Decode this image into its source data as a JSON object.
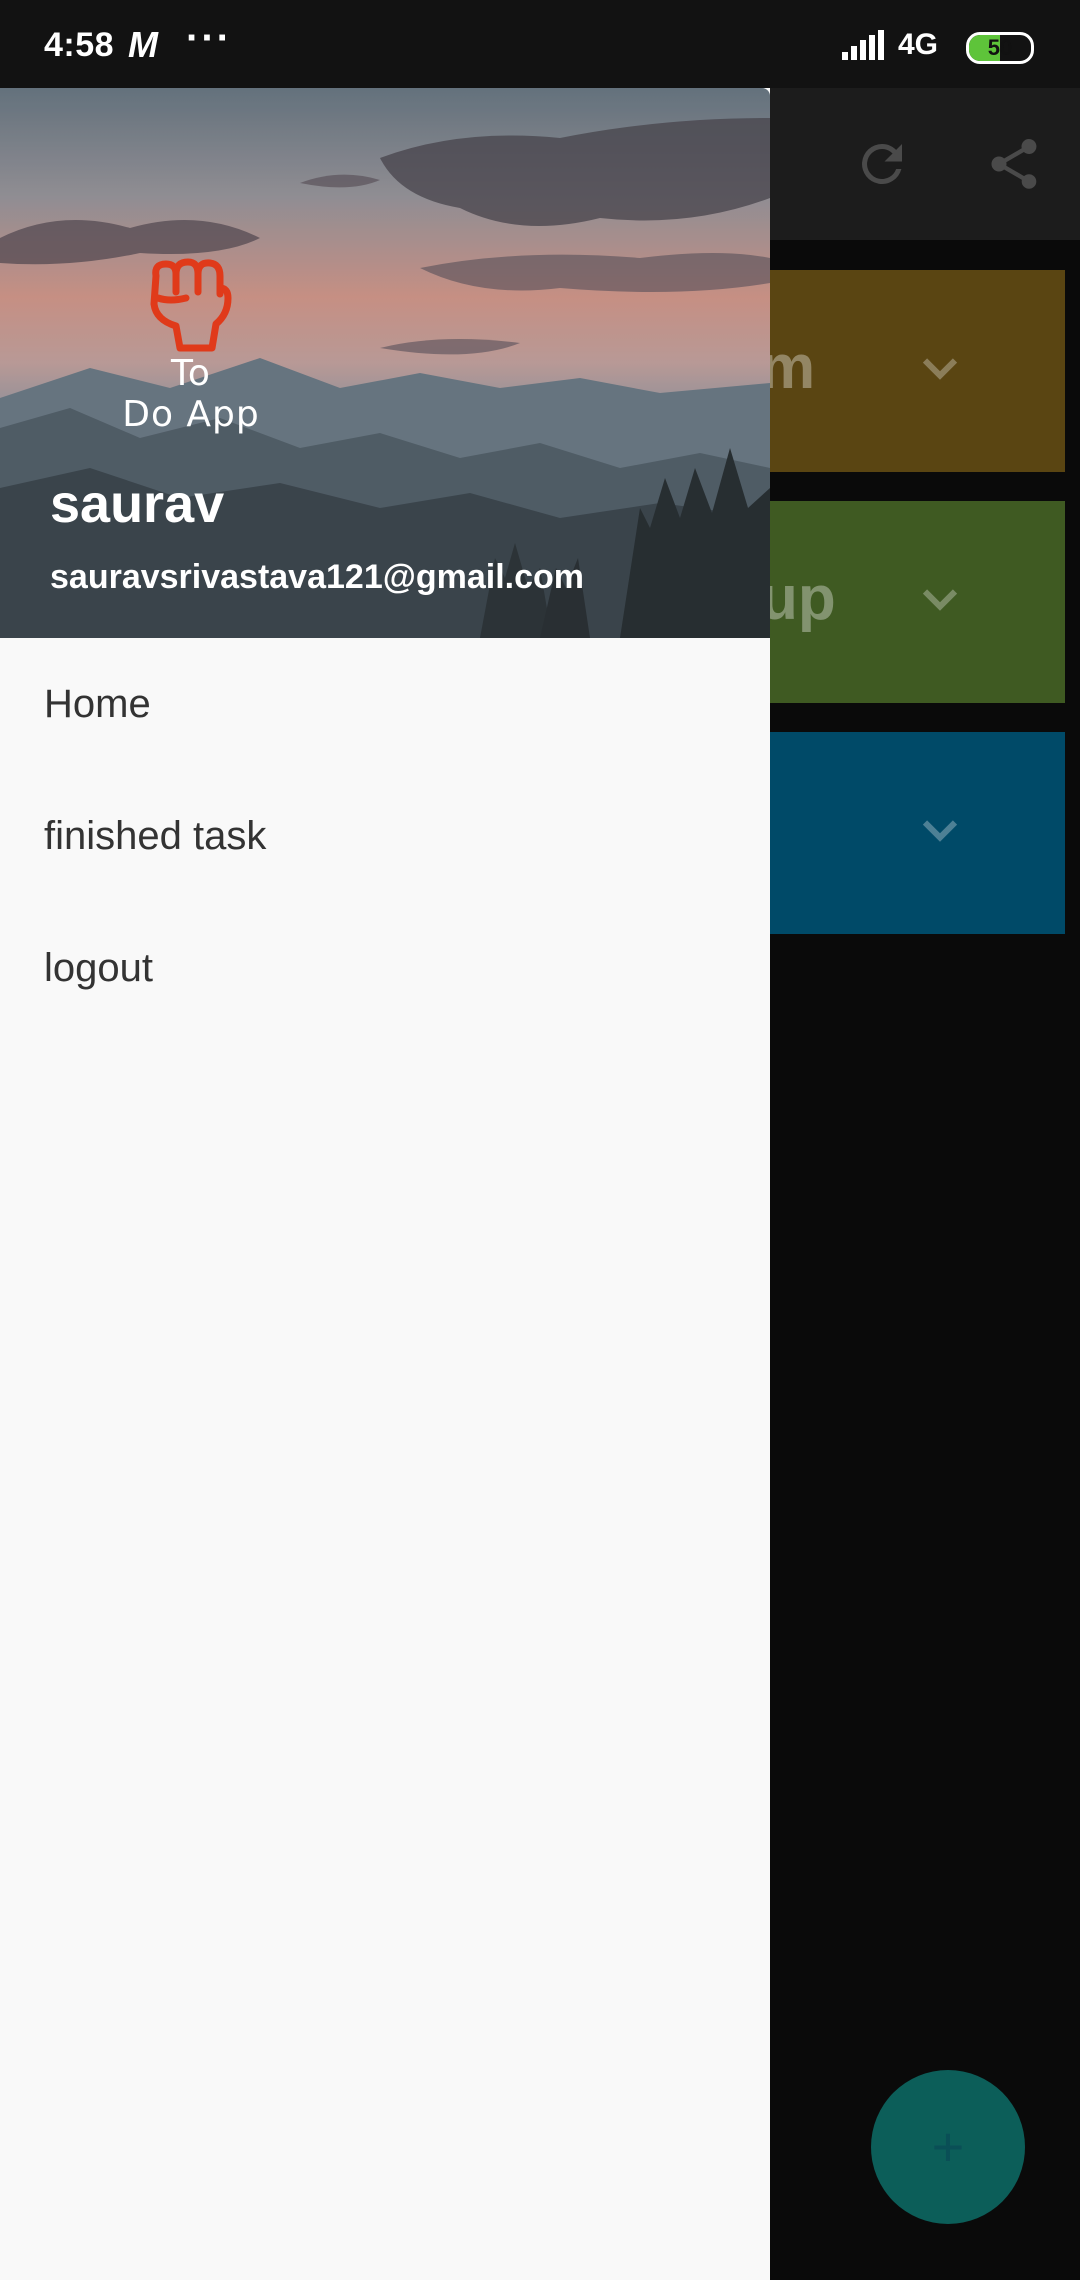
{
  "status_bar": {
    "time": "4:58",
    "app_glyph": "M",
    "more": "···",
    "network": "4G",
    "battery": "50",
    "battery_level": 0.5
  },
  "background": {
    "cards": [
      {
        "text": "m",
        "color": "#5a4512"
      },
      {
        "text": "up",
        "color": "#3f5a22"
      },
      {
        "text": "",
        "color": "#004a68"
      }
    ],
    "fab_label": "+"
  },
  "drawer": {
    "logo": {
      "line1": "To",
      "line2": "Do App"
    },
    "user_name": "saurav",
    "user_email": "sauravsrivastava121@gmail.com",
    "menu": [
      {
        "label": "Home"
      },
      {
        "label": "finished task"
      },
      {
        "label": "logout"
      }
    ]
  },
  "colors": {
    "drawer_bg": "#f9f9f9",
    "logo_red": "#e03a1a"
  }
}
